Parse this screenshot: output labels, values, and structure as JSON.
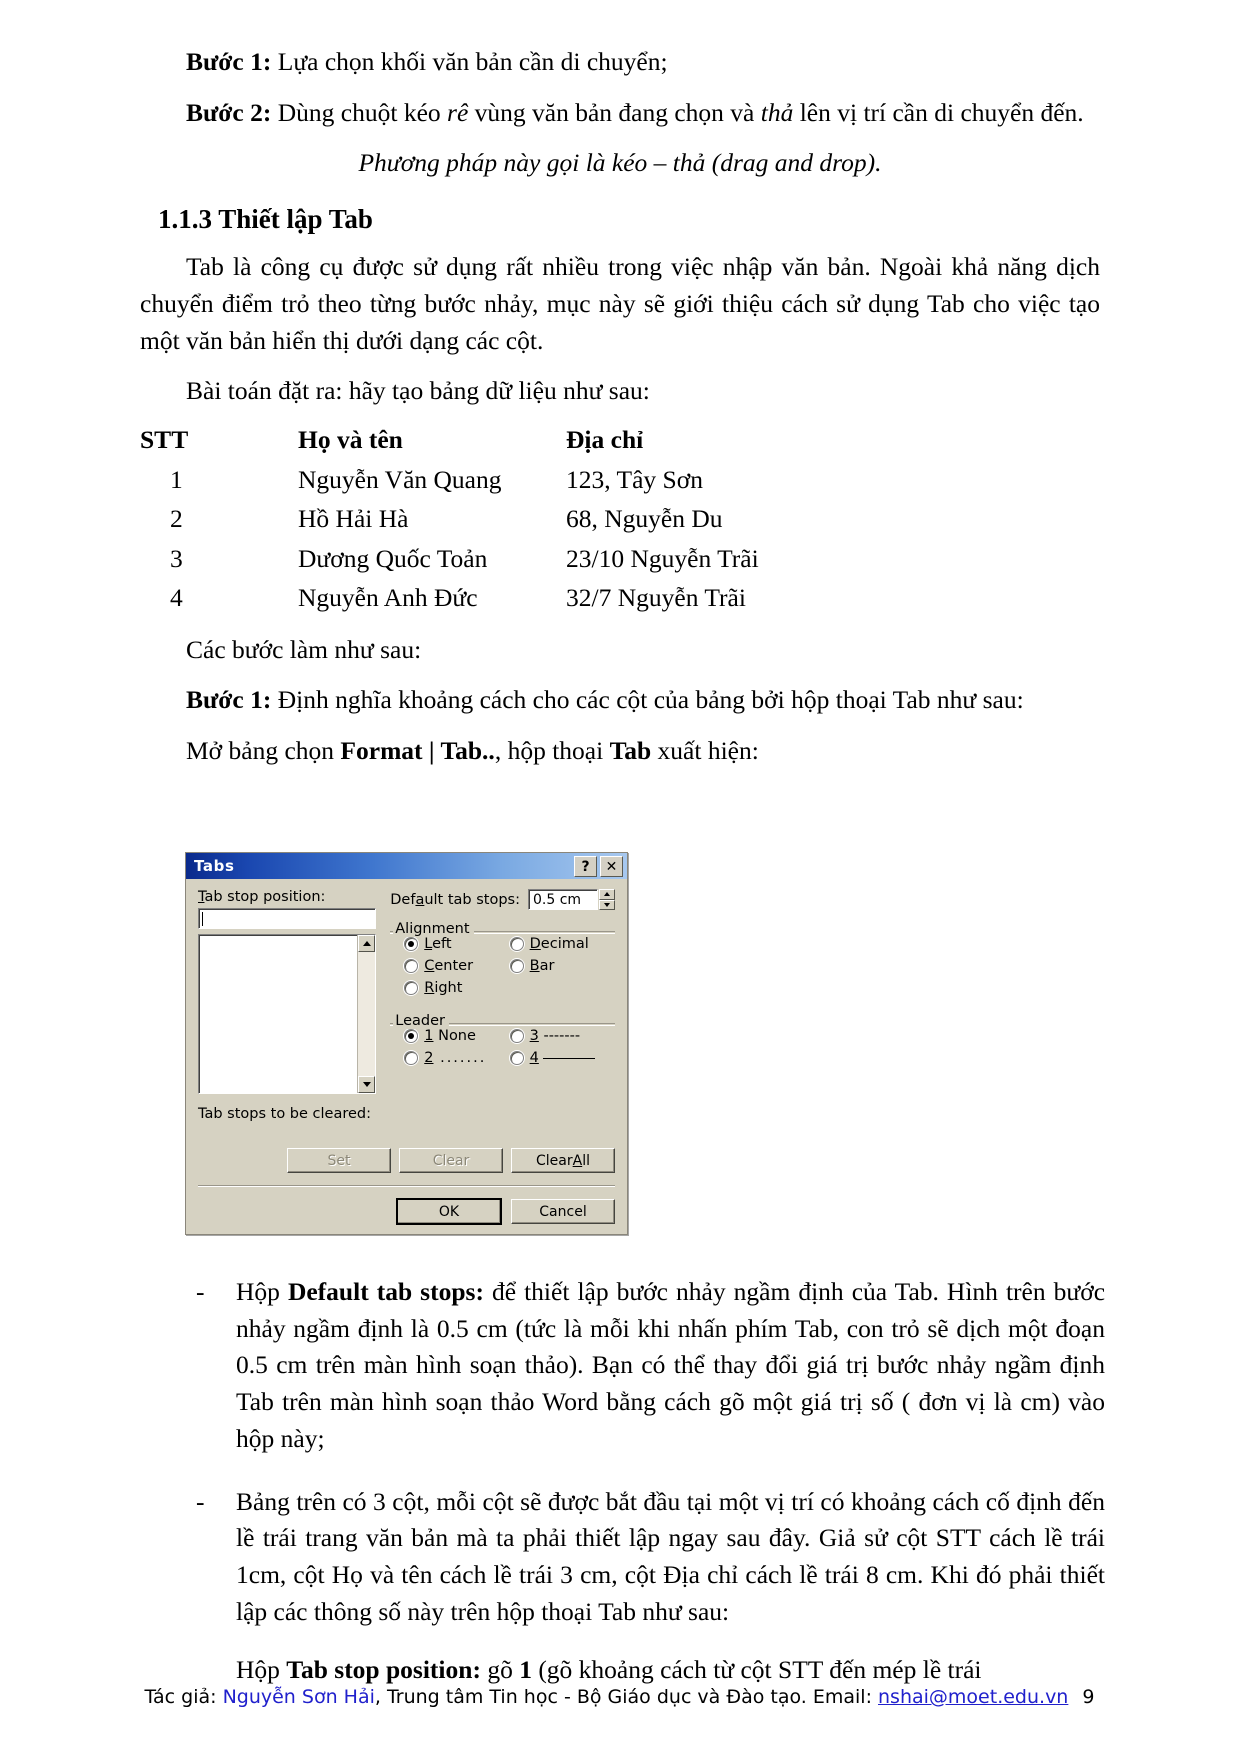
{
  "document": {
    "paragraphs": {
      "step1_label": "Bước 1:",
      "step1_text": " Lựa chọn khối văn bản cần di chuyển;",
      "step2_label": "Bước 2:",
      "step2_text_a": " Dùng chuột kéo ",
      "step2_italic_a": "rê",
      "step2_text_b": " vùng văn bản đang chọn và ",
      "step2_italic_b": "thả",
      "step2_text_c": " lên vị trí cần di chuyển đến.",
      "note_italic": "Phương pháp này gọi là kéo – thả (drag and drop).",
      "heading": "1.1.3 Thiết lập Tab",
      "intro": "Tab là công cụ được sử dụng rất nhiều trong việc nhập văn bản. Ngoài khả năng dịch chuyển điểm trỏ theo từng bước nhảy, mục này sẽ giới thiệu cách sử dụng Tab cho việc tạo một văn bản hiển thị dưới dạng các cột.",
      "problem": "Bài toán đặt ra: hãy tạo bảng dữ liệu như sau:",
      "steps_intro": "Các bước làm như sau:",
      "step_b1_label": "Bước 1:",
      "step_b1_text": " Định nghĩa khoảng cách cho các cột của bảng bởi hộp thoại Tab như sau:",
      "open_menu_a": "Mở bảng chọn ",
      "open_menu_bold1": "Format | Tab..",
      "open_menu_b": ", hộp thoại ",
      "open_menu_bold2": "Tab",
      "open_menu_c": " xuất hiện:"
    },
    "data_table": {
      "headers": [
        "STT",
        "Họ và tên",
        "Địa chỉ"
      ],
      "rows": [
        [
          "1",
          "Nguyễn Văn Quang",
          "123, Tây Sơn"
        ],
        [
          "2",
          "Hồ Hải Hà",
          "68, Nguyễn Du"
        ],
        [
          "3",
          "Dương Quốc Toản",
          "23/10 Nguyễn Trãi"
        ],
        [
          "4",
          "Nguyễn Anh Đức",
          "32/7 Nguyễn Trãi"
        ]
      ]
    },
    "bullets": [
      {
        "dash": "-",
        "lead": "Hộp ",
        "bold": "Default tab stops:",
        "text": " để thiết lập bước nhảy ngầm định của Tab. Hình trên bước nhảy ngầm định là 0.5 cm (tức là mỗi khi nhấn phím Tab, con trỏ sẽ dịch một đoạn 0.5 cm trên màn hình soạn thảo). Bạn có thể thay đổi giá trị bước nhảy ngầm định Tab trên màn hình soạn thảo Word bằng cách gõ một giá trị số ( đơn vị là cm) vào hộp này;"
      },
      {
        "dash": "-",
        "lead": "",
        "bold": "",
        "text": "Bảng trên có 3 cột, mỗi cột sẽ được bắt đầu tại một vị trí có khoảng cách cố định đến lề trái trang văn bản mà ta phải thiết lập ngay sau đây. Giả sử cột STT cách lề trái 1cm, cột Họ và tên cách lề trái 3 cm, cột Địa chỉ cách lề trái 8 cm. Khi đó phải thiết lập các thông số này trên hộp thoại Tab như sau:"
      }
    ],
    "last_paragraph": {
      "lead": "Hộp ",
      "bold": "Tab stop position:",
      "text_a": " gõ ",
      "bold2": "1",
      "text_b": " (gõ khoảng cách từ cột STT đến mép lề trái"
    }
  },
  "dialog": {
    "title": "Tabs",
    "titlebar_buttons": [
      {
        "icon": "help-icon",
        "label": "?"
      },
      {
        "icon": "close-icon",
        "label": "✕"
      }
    ],
    "tab_stop_position": {
      "label_pre": "T",
      "label_rest": "ab stop position:",
      "value": ""
    },
    "default_tab_stops": {
      "label_pre": "Def",
      "label_mid": "a",
      "label_rest": "ult tab stops:",
      "value": "0.5 cm"
    },
    "alignment": {
      "legend": "Alignment",
      "options": [
        {
          "label_pre": "",
          "underline": "L",
          "label_rest": "eft",
          "selected": true
        },
        {
          "label_pre": "",
          "underline": "C",
          "label_rest": "enter",
          "selected": false
        },
        {
          "label_pre": "",
          "underline": "R",
          "label_rest": "ight",
          "selected": false
        },
        {
          "label_pre": "",
          "underline": "D",
          "label_rest": "ecimal",
          "selected": false
        },
        {
          "label_pre": "",
          "underline": "B",
          "label_rest": "ar",
          "selected": false
        }
      ]
    },
    "leader": {
      "legend": "Leader",
      "options": [
        {
          "underline": "1",
          "label_rest": " None",
          "selected": true,
          "style": "none"
        },
        {
          "underline": "2",
          "label_rest": " .......",
          "selected": false,
          "style": "dots"
        },
        {
          "underline": "3",
          "label_rest": " -------",
          "selected": false,
          "style": "dash"
        },
        {
          "underline": "4",
          "label_rest": " ",
          "selected": false,
          "style": "line"
        }
      ]
    },
    "tab_stops_cleared_label": "Tab stops to be cleared:",
    "buttons": {
      "set": {
        "label": "Set",
        "disabled": true
      },
      "clear": {
        "label": "Clear",
        "disabled": true
      },
      "clear_all_pre": "Clear ",
      "clear_all_underline": "A",
      "clear_all_post": "ll",
      "ok": "OK",
      "cancel": "Cancel"
    }
  },
  "footer": {
    "prefix": "Tác giả: ",
    "author": "Nguyễn Sơn Hải",
    "middle": ", Trung tâm Tin học - Bộ Giáo dục và Đào tạo. Email: ",
    "email": "nshai@moet.edu.vn",
    "page_number": "9",
    "link_color": "#2020cc"
  }
}
